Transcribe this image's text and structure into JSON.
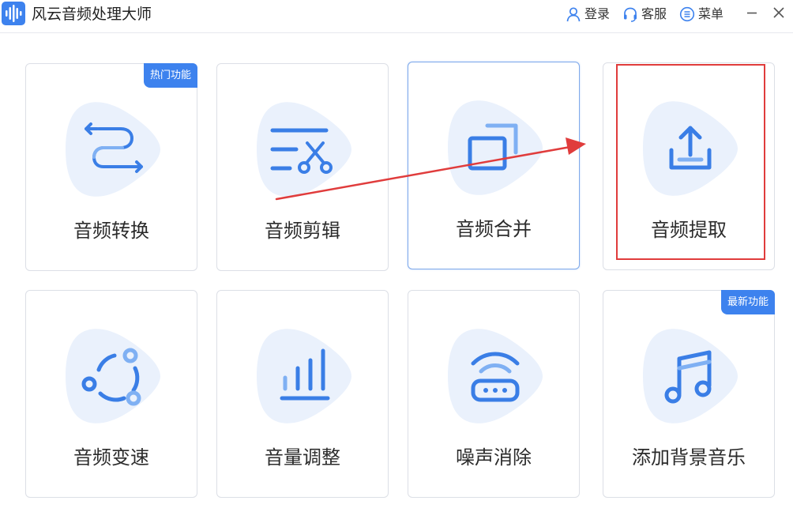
{
  "app": {
    "title": "风云音频处理大师"
  },
  "titlebar": {
    "login_label": "登录",
    "service_label": "客服",
    "menu_label": "菜单"
  },
  "cards": [
    {
      "label": "音频转换",
      "badge": "热门功能",
      "icon": "convert-arrows-icon"
    },
    {
      "label": "音频剪辑",
      "icon": "scissors-icon"
    },
    {
      "label": "音频合并",
      "icon": "merge-squares-icon"
    },
    {
      "label": "音频提取",
      "icon": "upload-tray-icon"
    },
    {
      "label": "音频变速",
      "icon": "circular-nodes-icon"
    },
    {
      "label": "音量调整",
      "icon": "volume-bars-icon"
    },
    {
      "label": "噪声消除",
      "icon": "wifi-router-icon"
    },
    {
      "label": "添加背景音乐",
      "badge": "最新功能",
      "icon": "music-note-icon"
    }
  ],
  "colors": {
    "accent": "#3d82ee",
    "icon_blue": "#3a7ee6",
    "blob": "#eaf1fc",
    "annotation_red": "#e03c3c",
    "card_border": "#dcdfe6"
  }
}
